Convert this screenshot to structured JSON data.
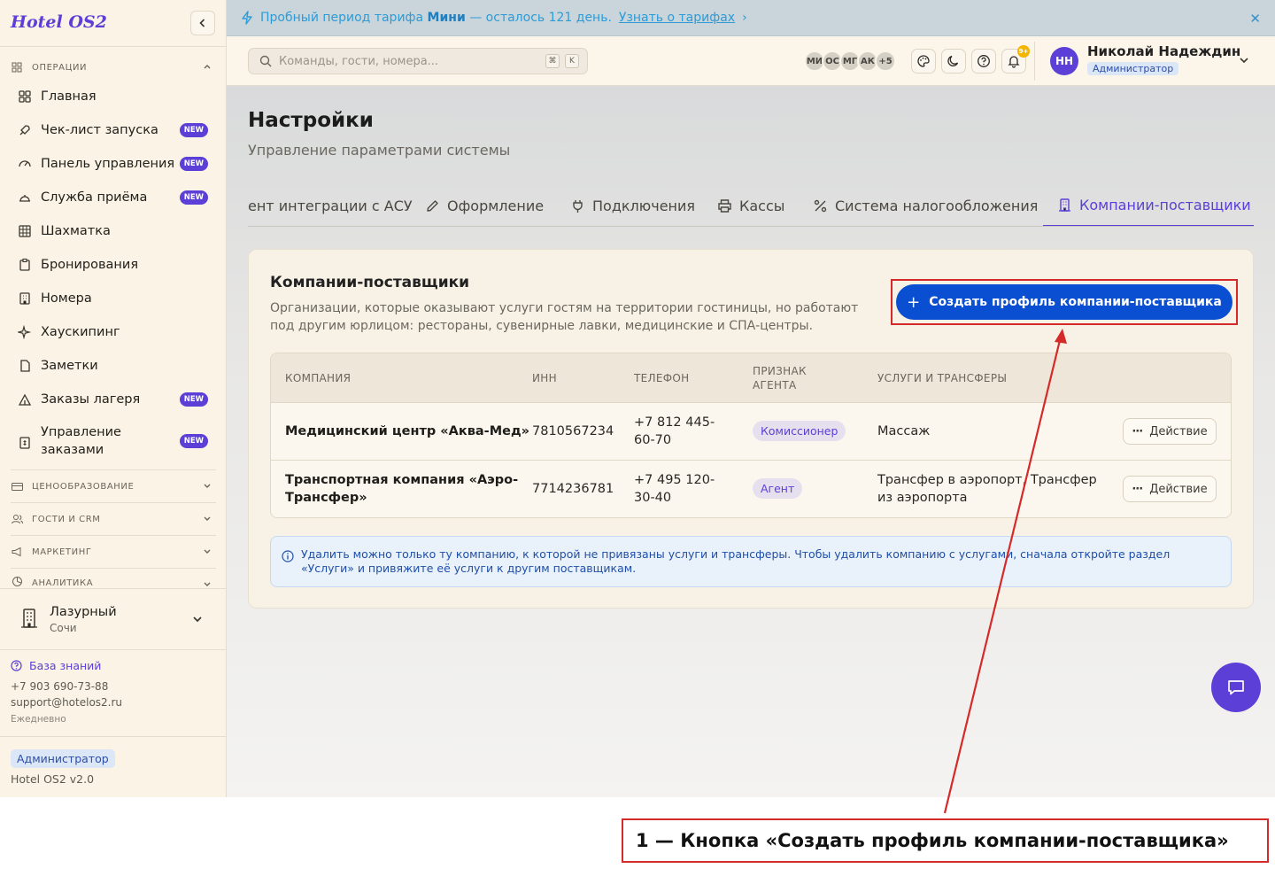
{
  "app": {
    "logo": "Hotel OS2"
  },
  "sidebar": {
    "sections": [
      {
        "label": "ОПЕРАЦИИ"
      },
      {
        "label": "ЦЕНООБРАЗОВАНИЕ"
      },
      {
        "label": "ГОСТИ И CRM"
      },
      {
        "label": "МАРКЕТИНГ"
      },
      {
        "label": "АНАЛИТИКА"
      }
    ],
    "items": [
      {
        "label": "Главная",
        "icon": "grid-icon"
      },
      {
        "label": "Чек-лист запуска",
        "icon": "rocket-icon",
        "badge": "NEW"
      },
      {
        "label": "Панель управления",
        "icon": "gauge-icon",
        "badge": "NEW"
      },
      {
        "label": "Служба приёма",
        "icon": "bell-desk-icon",
        "badge": "NEW"
      },
      {
        "label": "Шахматка",
        "icon": "table-icon"
      },
      {
        "label": "Бронирования",
        "icon": "clipboard-icon"
      },
      {
        "label": "Номера",
        "icon": "building-icon"
      },
      {
        "label": "Хаускипинг",
        "icon": "sparkles-icon"
      },
      {
        "label": "Заметки",
        "icon": "note-icon"
      },
      {
        "label": "Заказы лагеря",
        "icon": "tent-icon",
        "badge": "NEW"
      },
      {
        "label": "Управление",
        "label2": "заказами",
        "icon": "receipt-icon",
        "badge": "NEW"
      }
    ],
    "hotel": {
      "name": "Лазурный",
      "city": "Сочи"
    },
    "knowledge_base": "База знаний",
    "phone": "+7 903 690-73-88",
    "email": "support@hotelos2.ru",
    "schedule": "Ежедневно",
    "role": "Администратор",
    "version": "Hotel OS2 v2.0"
  },
  "banner": {
    "text_prefix": "Пробный период тарифа",
    "plan": "Мини",
    "text_suffix": "— осталось 121 день.",
    "link": "Узнать о тарифах",
    "link_arrow": "›",
    "close": "✕"
  },
  "header": {
    "search_placeholder": "Команды, гости, номера...",
    "kbd1": "⌘",
    "kbd2": "K",
    "avatars": [
      "МИ",
      "ОС",
      "МГ",
      "АК",
      "+5"
    ],
    "notif_count": "9+",
    "user_initials": "НН",
    "user_name": "Николай Надеждин",
    "user_role": "Администратор"
  },
  "page": {
    "title": "Настройки",
    "subtitle": "Управление параметрами системы",
    "tabs": [
      {
        "label": "ент интеграции с АСУ"
      },
      {
        "label": "Оформление",
        "icon": "pencil-icon"
      },
      {
        "label": "Подключения",
        "icon": "plug-icon"
      },
      {
        "label": "Кассы",
        "icon": "printer-icon"
      },
      {
        "label": "Система налогообложения",
        "icon": "percent-icon"
      },
      {
        "label": "Компании-поставщики",
        "icon": "building-icon",
        "active": true
      }
    ]
  },
  "card": {
    "title": "Компании-поставщики",
    "description": "Организации, которые оказывают услуги гостям на территории гостиницы, но работают под другим юрлицом: рестораны, сувенирные лавки, медицинские и СПА-центры.",
    "create_button": "Создать профиль компании-поставщика",
    "create_icon": "+",
    "columns": [
      "КОМПАНИЯ",
      "ИНН",
      "ТЕЛЕФОН",
      "ПРИЗНАК",
      "АГЕНТА",
      "УСЛУГИ И ТРАНСФЕРЫ"
    ],
    "rows": [
      {
        "name": "Медицинский центр «Аква-Мед»",
        "inn": "7810567234",
        "phone1": "+7 812 445-",
        "phone2": "60-70",
        "agent": "Комиссионер",
        "services1": "Массаж",
        "services2": "",
        "action": "Действие"
      },
      {
        "name1": "Транспортная компания «Аэро-",
        "name2": "Трансфер»",
        "inn": "7714236781",
        "phone1": "+7 495 120-",
        "phone2": "30-40",
        "agent": "Агент",
        "services1": "Трансфер в аэропорт, Трансфер",
        "services2": "из аэропорта",
        "action": "Действие"
      }
    ],
    "info": "Удалить можно только ту компанию, к которой не привязаны услуги и трансферы. Чтобы удалить компанию с услугами, сначала откройте раздел «Услуги» и привяжите её услуги к другим поставщикам."
  },
  "annotation": {
    "callout": "1 — Кнопка «Создать профиль компании-поставщика»"
  },
  "colors": {
    "accent": "#5b3fd6",
    "primary_button": "#0a4fd1",
    "annotation": "#d42a2a"
  }
}
